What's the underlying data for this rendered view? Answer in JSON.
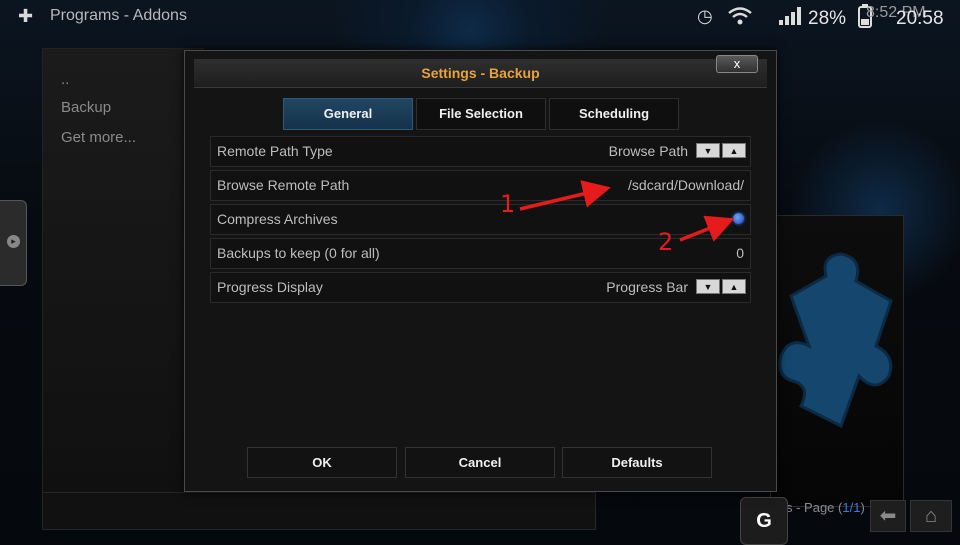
{
  "status_bar": {
    "app_title": "Programs - Addons",
    "battery": "28%",
    "time": "20:58",
    "overlay_time": "8:52 PM"
  },
  "left_panel": {
    "items": [
      "..",
      "Backup",
      "Get more..."
    ]
  },
  "footer": {
    "page_prefix": "s - Page (",
    "page_value": "1/1",
    "page_suffix": ")"
  },
  "g_button": "G",
  "dialog": {
    "title": "Settings - Backup",
    "close_label": "x",
    "tabs": [
      {
        "label": "General",
        "active": true
      },
      {
        "label": "File Selection",
        "active": false
      },
      {
        "label": "Scheduling",
        "active": false
      }
    ],
    "rows": [
      {
        "label": "Remote Path Type",
        "value": "Browse Path"
      },
      {
        "label": "Browse Remote Path",
        "value": "/sdcard/Download/"
      },
      {
        "label": "Compress Archives",
        "value": ""
      },
      {
        "label": "Backups to keep (0 for all)",
        "value": "0"
      },
      {
        "label": "Progress Display",
        "value": "Progress Bar"
      }
    ],
    "buttons": {
      "ok": "OK",
      "cancel": "Cancel",
      "defaults": "Defaults"
    }
  },
  "annotations": [
    "1",
    "2"
  ],
  "colors": {
    "accent_title": "#e8a33a",
    "annotation": "#e61b1b",
    "active_tab": "#214663",
    "radio_on": "#2a6ee6"
  }
}
